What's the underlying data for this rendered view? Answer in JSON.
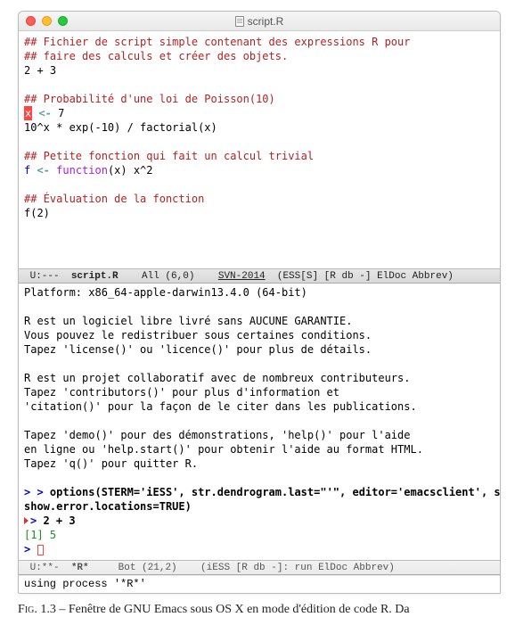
{
  "window": {
    "title": "script.R",
    "traffic_colors": {
      "red": "#ff5f56",
      "yellow": "#ffbd2e",
      "green": "#27c93f"
    }
  },
  "editor": {
    "lines": {
      "c1": "## Fichier de script simple contenant des expressions R pour",
      "c2": "## faire des calculs et créer des objets.",
      "e1": "2 + 3",
      "c3": "## Probabilité d'une loi de Poisson(10)",
      "e2a": "x",
      "e2_assign": " <- ",
      "e2b": "7",
      "e3": "10^x * exp(-10) / factorial(x)",
      "c4": "## Petite fonction qui fait un calcul trivial",
      "e4a": "f",
      "e4_assign": " <- ",
      "e4_kw": "function",
      "e4b": "(x) x^2",
      "c5": "## Évaluation de la fonction",
      "e5": "f(2)"
    }
  },
  "modeline_top": {
    "left": " U:---  ",
    "buffer": "script.R",
    "middle": "    All (6,0)    ",
    "svn": "SVN-2014",
    "right": "  (ESS[S] [R db -] ElDoc Abbrev)"
  },
  "repl": {
    "l1": "Platform: x86_64-apple-darwin13.4.0 (64-bit)",
    "blank": "",
    "l2": "R est un logiciel libre livré sans AUCUNE GARANTIE.",
    "l3": "Vous pouvez le redistribuer sous certaines conditions.",
    "l4": "Tapez 'license()' ou 'licence()' pour plus de détails.",
    "l5": "R est un projet collaboratif avec de nombreux contributeurs.",
    "l6": "Tapez 'contributors()' pour plus d'information et",
    "l7": "'citation()' pour la façon de le citer dans les publications.",
    "l8": "Tapez 'demo()' pour des démonstrations, 'help()' pour l'aide",
    "l9": "en ligne ou 'help.start()' pour obtenir l'aide au format HTML.",
    "l10": "Tapez 'q()' pour quitter R.",
    "p_opt_prompt": "> > ",
    "p_opt_cmd": "options(STERM='iESS', str.dendrogram.last=\"'\", editor='emacsclient', s",
    "p_opt_wrap": "show.error.locations=TRUE)",
    "p_calc_prompt": "> ",
    "p_calc_cmd": "2 + 3",
    "p_res": "[1] 5",
    "p_last_prompt": "> "
  },
  "modeline_bottom": {
    "left": " U:**-  ",
    "buffer": "*R*",
    "middle": "     Bot (21,2)    ",
    "right": "(iESS [R db -]: run ElDoc Abbrev)"
  },
  "echo": "using process '*R*'",
  "caption": {
    "label": "Fig. 1.3",
    "dash": " – ",
    "text": "Fenêtre de GNU Emacs sous OS X en mode d'édition de code R. Da"
  }
}
